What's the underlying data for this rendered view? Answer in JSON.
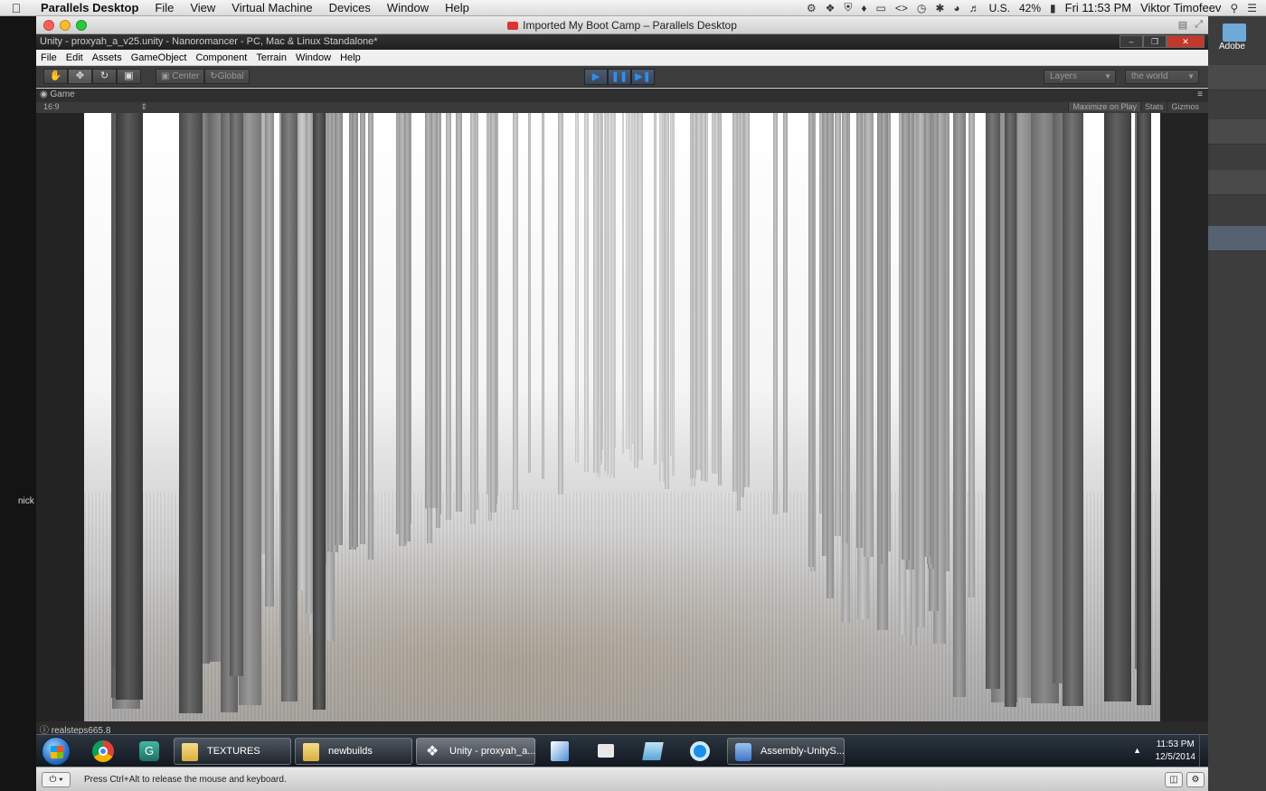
{
  "mac_menubar": {
    "app_name": "Parallels Desktop",
    "menus": [
      "File",
      "View",
      "Virtual Machine",
      "Devices",
      "Window",
      "Help"
    ],
    "input_source": "U.S.",
    "battery": "42%",
    "clock": "Fri 11:53 PM",
    "user": "Viktor Timofeev"
  },
  "desktop": {
    "left_label": "nick",
    "right_folder_label": "Adobe"
  },
  "parallels_window": {
    "title": "Imported My Boot Camp – Parallels Desktop",
    "status_message": "Press Ctrl+Alt to release the mouse and keyboard."
  },
  "unity": {
    "window_title": "Unity - proxyah_a_v25.unity - Nanoromancer - PC, Mac & Linux Standalone*",
    "menus": [
      "File",
      "Edit",
      "Assets",
      "GameObject",
      "Component",
      "Terrain",
      "Window",
      "Help"
    ],
    "pivot_mode": "Center",
    "pivot_space": "Global",
    "layers_dropdown": "Layers",
    "layout_dropdown": "the world",
    "game_tab": "Game",
    "aspect": "16:9",
    "maximize_on_play": "Maximize on Play",
    "stats": "Stats",
    "gizmos": "Gizmos",
    "console_line": "realsteps665.8"
  },
  "taskbar": {
    "tasks": [
      {
        "label": "TEXTURES"
      },
      {
        "label": "newbuilds"
      },
      {
        "label": "Unity - proxyah_a..."
      },
      {
        "label": "Assembly-UnityS..."
      }
    ],
    "time": "11:53 PM",
    "date": "12/5/2014"
  },
  "colors": {
    "play_accent": "#2d8ff0",
    "close_red": "#c4372a"
  }
}
